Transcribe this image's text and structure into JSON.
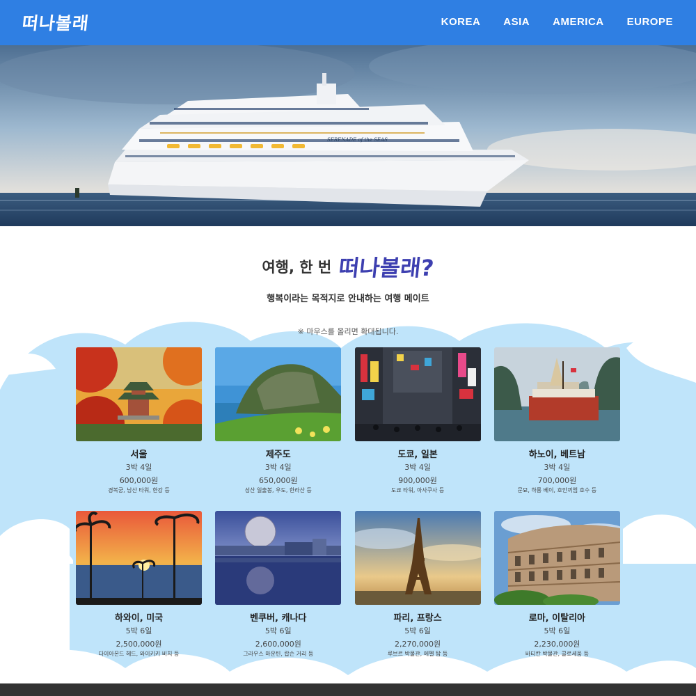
{
  "header": {
    "logo": "떠나볼래",
    "nav": [
      "KOREA",
      "ASIA",
      "AMERICA",
      "EUROPE"
    ]
  },
  "hero": {
    "ship_name": "SERENADE of the SEAS"
  },
  "intro": {
    "title_prefix": "여행, 한 번",
    "title_brand": "떠나볼래?",
    "subtitle": "행복이라는 목적지로 안내하는 여행 메이트",
    "note": "※ 마우스를 올리면 확대됩니다."
  },
  "colors": {
    "header_bg": "#2f7fe3",
    "brand_text": "#3d3fb0",
    "cloud_bg": "#bfe4fa",
    "footer_bg": "#333333"
  },
  "destinations": [
    {
      "name": "서울",
      "duration": "3박 4일",
      "price": "600,000원",
      "desc": "경복궁, 남산 타워, 한강 등",
      "image": "seoul-palace-autumn"
    },
    {
      "name": "제주도",
      "duration": "3박 4일",
      "price": "650,000원",
      "desc": "성산 일출봉, 우도, 한라산 등",
      "image": "jeju-seongsan"
    },
    {
      "name": "도쿄, 일본",
      "duration": "3박 4일",
      "price": "900,000원",
      "desc": "도쿄 타워, 아사쿠사 등",
      "image": "tokyo-street"
    },
    {
      "name": "하노이, 베트남",
      "duration": "3박 4일",
      "price": "700,000원",
      "desc": "문묘, 하롱 베이, 호안끼엠 호수 등",
      "image": "halong-bay-boat"
    },
    {
      "name": "하와이, 미국",
      "duration": "5박 6일",
      "price": "2,500,000원",
      "desc": "다이아몬드 헤드, 와이키키 비치 등",
      "image": "hawaii-sunset-palms"
    },
    {
      "name": "벤쿠버, 캐나다",
      "duration": "5박 6일",
      "price": "2,600,000원",
      "desc": "그라우스 마운틴, 랍슨 거리 등",
      "image": "vancouver-science-world"
    },
    {
      "name": "파리, 프랑스",
      "duration": "5박 6일",
      "price": "2,270,000원",
      "desc": "루브르 박물관, 에펠 탑 등",
      "image": "paris-eiffel-tower"
    },
    {
      "name": "로마, 이탈리아",
      "duration": "5박 6일",
      "price": "2,230,000원",
      "desc": "바티칸 박물관, 콜로세움 등",
      "image": "rome-colosseum"
    }
  ]
}
